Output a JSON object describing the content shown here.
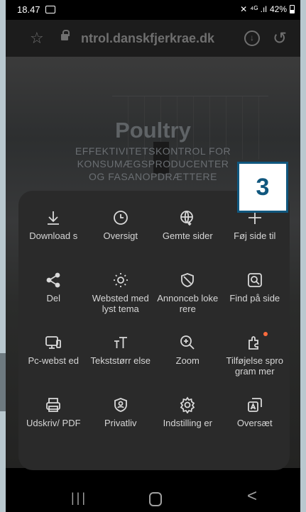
{
  "status_bar": {
    "time": "18.47",
    "signal": "⁴ᴳ .ıl",
    "battery": "42%"
  },
  "url_bar": {
    "url": "ntrol.danskfjerkrae.dk"
  },
  "page": {
    "hero_title": "Poultry",
    "hero_subtitle_lines": [
      "EFFEKTIVITETSKONTROL FOR",
      "KONSUMÆGSPRODUCENTER",
      "OG FASANOPDRÆTTERE"
    ]
  },
  "annotation": {
    "label": "3"
  },
  "menu": {
    "items": [
      {
        "label": "Download s",
        "icon": "download-icon"
      },
      {
        "label": "Oversigt",
        "icon": "history-icon"
      },
      {
        "label": "Gemte sider",
        "icon": "saved-pages-icon"
      },
      {
        "label": "Føj side til",
        "icon": "add-icon"
      },
      {
        "label": "Del",
        "icon": "share-icon"
      },
      {
        "label": "Websted med lyst tema",
        "icon": "light-theme-icon"
      },
      {
        "label": "Annonceb lokerere",
        "icon": "ad-blocker-icon"
      },
      {
        "label": "Find på side",
        "icon": "find-on-page-icon"
      },
      {
        "label": "Pc-webst ed",
        "icon": "desktop-site-icon"
      },
      {
        "label": "Tekststørr else",
        "icon": "text-size-icon"
      },
      {
        "label": "Zoom",
        "icon": "zoom-icon"
      },
      {
        "label": "Tilføjelse sprogram mer",
        "icon": "add-ons-icon"
      },
      {
        "label": "Udskriv/ PDF",
        "icon": "print-icon"
      },
      {
        "label": "Privatliv",
        "icon": "privacy-icon"
      },
      {
        "label": "Indstilling er",
        "icon": "settings-icon"
      },
      {
        "label": "Oversæt",
        "icon": "translate-icon"
      }
    ]
  },
  "navbar": {
    "recent": "|||",
    "back": "<"
  }
}
